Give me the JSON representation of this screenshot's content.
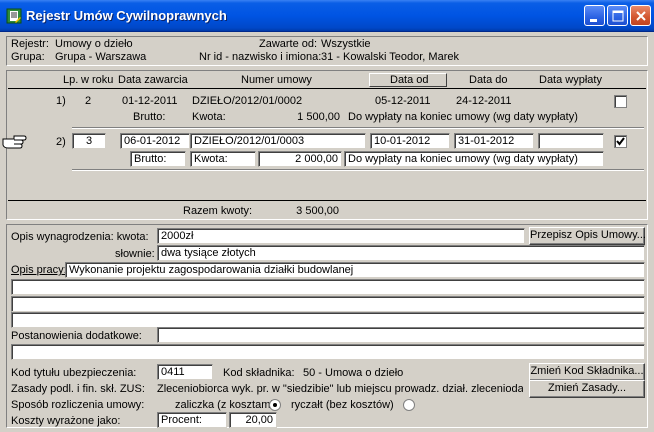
{
  "window": {
    "title": "Rejestr Umów Cywilnoprawnych"
  },
  "header": {
    "rejestr_label": "Rejestr:",
    "rejestr_value": "Umowy o dzieło",
    "grupa_label": "Grupa:",
    "grupa_value": "Grupa - Warszawa",
    "zawarte_label": "Zawarte od:",
    "zawarte_value": "Wszystkie",
    "nrid_label": "Nr id - nazwisko i imiona:",
    "nrid_value": "31 - Kowalski Teodor, Marek"
  },
  "table": {
    "columns": {
      "lp": "Lp.",
      "w_roku": "w roku",
      "data_zawarcia": "Data zawarcia",
      "numer_umowy": "Numer umowy",
      "data_od": "Data od",
      "data_do": "Data do",
      "data_wyplaty": "Data wypłaty"
    },
    "rows": [
      {
        "lp": "1)",
        "w_roku": "2",
        "data_zawarcia": "01-12-2011",
        "numer_umowy": "DZIEŁO/2012/01/0002",
        "data_od": "05-12-2011",
        "data_do": "24-12-2011",
        "data_wyplaty": "",
        "brutto_label": "Brutto:",
        "kwota_label": "Kwota:",
        "kwota": "1 500,00",
        "wyplata_opis": "Do wypłaty na koniec umowy (wg daty wypłaty)",
        "checked": false
      },
      {
        "lp": "2)",
        "w_roku": "3",
        "data_zawarcia": "06-01-2012",
        "numer_umowy": "DZIEŁO/2012/01/0003",
        "data_od": "10-01-2012",
        "data_do": "31-01-2012",
        "data_wyplaty": "",
        "brutto_label": "Brutto:",
        "kwota_label": "Kwota:",
        "kwota": "2 000,00",
        "wyplata_opis": "Do wypłaty na koniec umowy (wg daty wypłaty)",
        "checked": true
      }
    ],
    "razem_label": "Razem kwoty:",
    "razem_value": "3 500,00"
  },
  "details": {
    "opis_wynagrodzenia_label": "Opis wynagrodzenia: kwota:",
    "kwota_value": "2000zł",
    "przepisz_button": "Przepisz Opis Umowy...",
    "slownie_label": "słownie:",
    "slownie_value": "dwa tysiące złotych",
    "opis_pracy_label": "Opis pracy:",
    "opis_pracy_value": "Wykonanie projektu zagospodarowania działki budowlanej",
    "postanowienia_label": "Postanowienia dodatkowe:",
    "postanowienia_value": "",
    "kod_tytulu_label": "Kod tytułu ubezpieczenia:",
    "kod_tytulu_value": "0411",
    "kod_skladnika_label": "Kod składnika:",
    "kod_skladnika_value": "50 - Umowa o dzieło",
    "zmien_kod_button": "Zmień Kod Składnika...",
    "zasady_label": "Zasady podl. i fin. skł. ZUS:",
    "zasady_value": "Zleceniobiorca wyk. pr. w \"siedzibie\" lub miejscu prowadz. dział. zleceniodaw",
    "zmien_zasady_button": "Zmień Zasady...",
    "sposob_label": "Sposób rozliczenia umowy:",
    "zaliczka_label": "zaliczka (z kosztami)",
    "ryczalt_label": "ryczałt (bez kosztów)",
    "koszty_label": "Koszty wyrażone jako:",
    "koszty_type": "Procent:",
    "koszty_value": "20,00"
  }
}
